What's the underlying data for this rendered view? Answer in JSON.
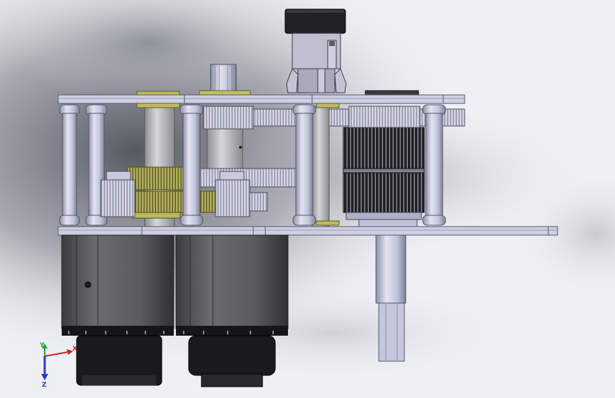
{
  "viewport": {
    "background": {
      "base": "#eef0f4",
      "shadow": "#6a6f78"
    },
    "model": {
      "colors": {
        "plate": "#c9cbe0",
        "plate_edge": "#6d6e82",
        "standoff": "#c4c6dc",
        "shaft_gray": "#b8b8be",
        "gear_light": "#d0d1e2",
        "gear_gold": "#a8a44e",
        "gear_dark": "#2b2c30",
        "motor_body": "#55565a",
        "motor_base": "#1a1a1c",
        "knob": "#222226"
      }
    },
    "triad": {
      "x_label": "X",
      "y_label": "Y",
      "z_label": "Z",
      "x_color": "#d4202a",
      "y_color": "#1ea83c",
      "z_color": "#2a3ad8"
    }
  }
}
